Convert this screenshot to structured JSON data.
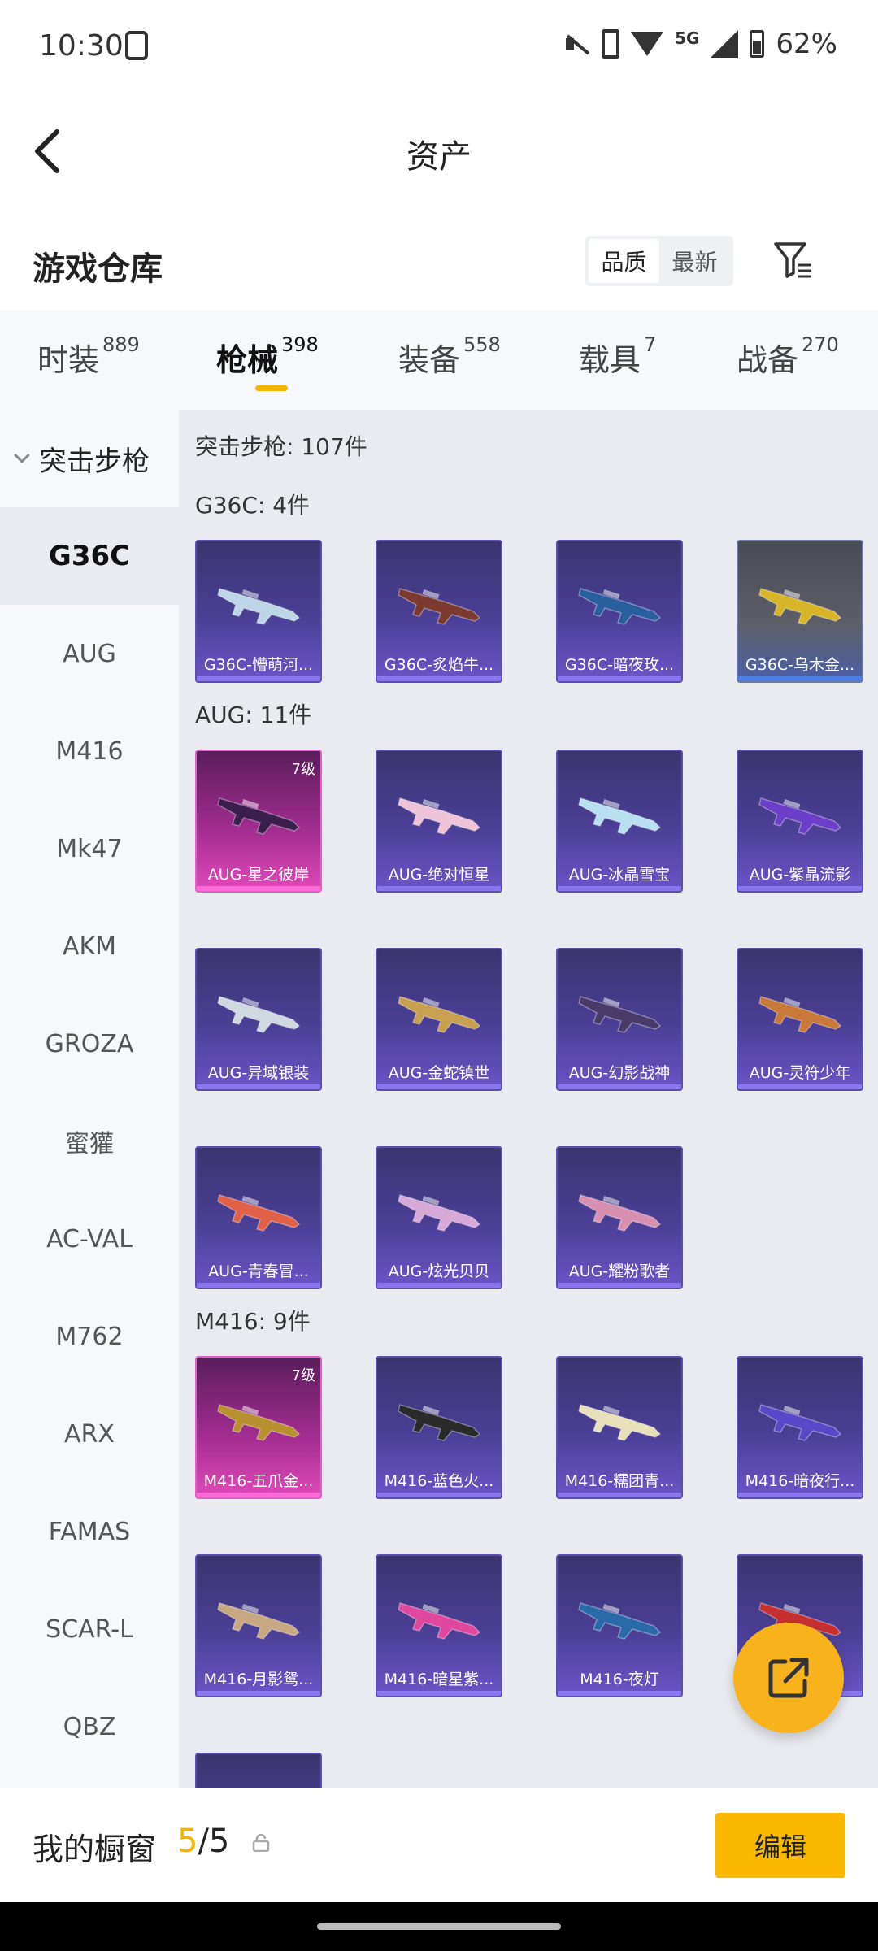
{
  "status": {
    "time": "10:30",
    "network": "5G",
    "battery": "62%"
  },
  "header": {
    "title": "资产"
  },
  "section": {
    "title": "游戏仓库"
  },
  "sort": {
    "quality": "品质",
    "latest": "最新"
  },
  "tabs": [
    {
      "label": "时装",
      "count": "889"
    },
    {
      "label": "枪械",
      "count": "398"
    },
    {
      "label": "装备",
      "count": "558"
    },
    {
      "label": "载具",
      "count": "7"
    },
    {
      "label": "战备",
      "count": "270"
    }
  ],
  "sidebar": {
    "header": "突击步枪",
    "items": [
      "G36C",
      "AUG",
      "M416",
      "Mk47",
      "AKM",
      "GROZA",
      "蜜獾",
      "AC-VAL",
      "M762",
      "ARX",
      "FAMAS",
      "SCAR-L",
      "QBZ"
    ]
  },
  "content": {
    "summary": "突击步枪: 107件",
    "groups": [
      {
        "label": "G36C: 4件",
        "items": [
          {
            "name": "G36C-懵萌河...",
            "style": "purple",
            "gun": "#bcd6e8"
          },
          {
            "name": "G36C-炙焰牛...",
            "style": "purple",
            "gun": "#7a3a2e"
          },
          {
            "name": "G36C-暗夜玫...",
            "style": "purple",
            "gun": "#2a5f9e"
          },
          {
            "name": "G36C-乌木金...",
            "style": "gray",
            "gun": "#d8b428"
          }
        ]
      },
      {
        "label": "AUG: 11件",
        "items": [
          {
            "name": "AUG-星之彼岸",
            "style": "pink",
            "level": "7级",
            "gun": "#3a1e4e"
          },
          {
            "name": "AUG-绝对恒星",
            "style": "purple",
            "gun": "#f0c4d8"
          },
          {
            "name": "AUG-冰晶雪宝",
            "style": "purple",
            "gun": "#b8e0f0"
          },
          {
            "name": "AUG-紫晶流影",
            "style": "purple",
            "gun": "#6b3fc8"
          },
          {
            "name": "AUG-异域银装",
            "style": "purple",
            "gun": "#d0d8e0"
          },
          {
            "name": "AUG-金蛇镇世",
            "style": "purple",
            "gun": "#c8a050"
          },
          {
            "name": "AUG-幻影战神",
            "style": "purple",
            "gun": "#4a3a6a"
          },
          {
            "name": "AUG-灵符少年",
            "style": "purple",
            "gun": "#c87838"
          },
          {
            "name": "AUG-青春冒...",
            "style": "purple",
            "gun": "#e06048"
          },
          {
            "name": "AUG-炫光贝贝",
            "style": "purple",
            "gun": "#d8a8d8"
          },
          {
            "name": "AUG-耀粉歌者",
            "style": "purple",
            "gun": "#d890b0"
          }
        ]
      },
      {
        "label": "M416: 9件",
        "items": [
          {
            "name": "M416-五爪金...",
            "style": "pink",
            "level": "7级",
            "gun": "#b89030"
          },
          {
            "name": "M416-蓝色火...",
            "style": "purple",
            "gun": "#2a2a2a"
          },
          {
            "name": "M416-糯团青...",
            "style": "purple",
            "gun": "#e8e0b8"
          },
          {
            "name": "M416-暗夜行...",
            "style": "purple",
            "gun": "#5a48c8"
          },
          {
            "name": "M416-月影鸳...",
            "style": "purple",
            "gun": "#c8a880"
          },
          {
            "name": "M416-暗星紫...",
            "style": "purple",
            "gun": "#e048a0"
          },
          {
            "name": "M416-夜灯",
            "style": "purple",
            "gun": "#2a6aa8"
          },
          {
            "name": "",
            "style": "purple",
            "gun": "#c83030"
          },
          {
            "name": "",
            "style": "purple",
            "gun": "#3a3a3a"
          }
        ]
      }
    ]
  },
  "bottom": {
    "showcase": "我的橱窗",
    "current": "5",
    "total": "/5",
    "edit": "编辑"
  },
  "colors": {
    "accent": "#f5b400",
    "card_purple": "#4b3f96",
    "card_pink": "#a12c8f"
  }
}
